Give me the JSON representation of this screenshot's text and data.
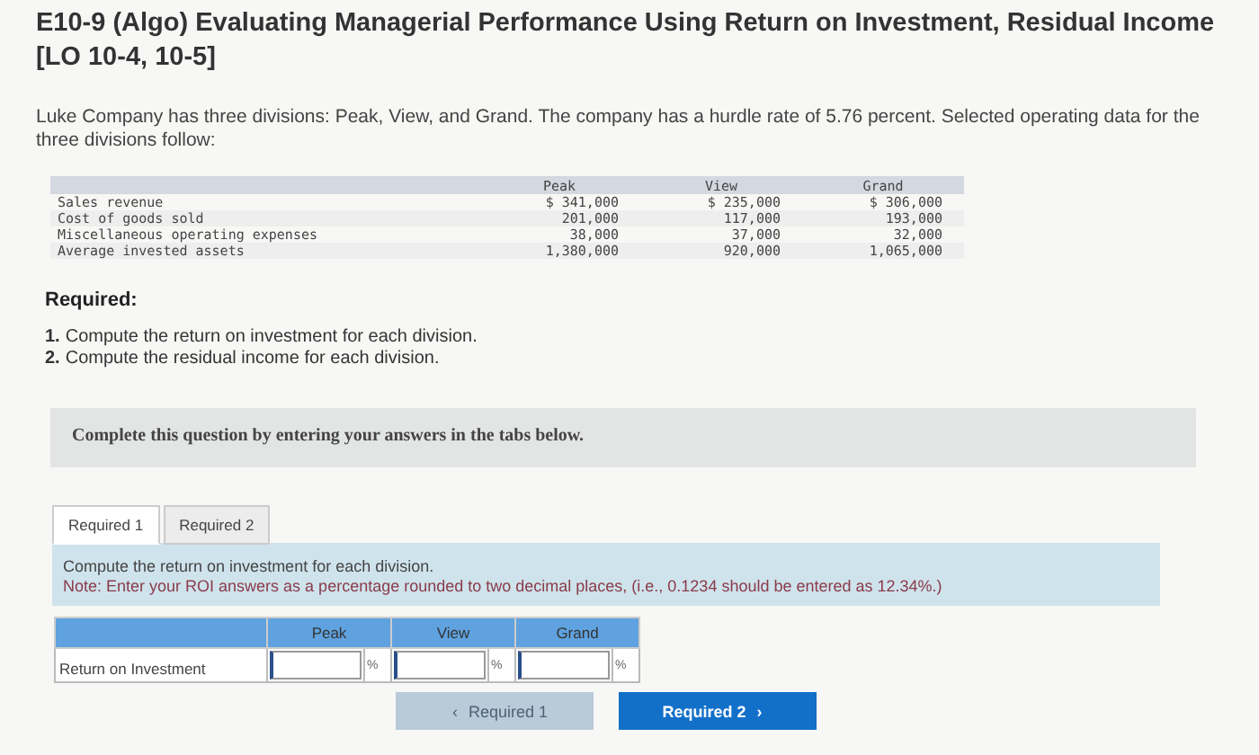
{
  "title": "E10-9 (Algo) Evaluating Managerial Performance Using Return on Investment, Residual Income [LO 10-4, 10-5]",
  "intro": "Luke Company has three divisions: Peak, View, and Grand. The company has a hurdle rate of 5.76 percent. Selected operating data for the three divisions follow:",
  "data_table": {
    "columns": [
      "Peak",
      "View",
      "Grand"
    ],
    "rows": [
      {
        "label": "Sales revenue",
        "values": [
          "$ 341,000",
          "$ 235,000",
          "$ 306,000"
        ]
      },
      {
        "label": "Cost of goods sold",
        "values": [
          "201,000",
          "117,000",
          "193,000"
        ]
      },
      {
        "label": "Miscellaneous operating expenses",
        "values": [
          "38,000",
          "37,000",
          "32,000"
        ]
      },
      {
        "label": "Average invested assets",
        "values": [
          "1,380,000",
          "920,000",
          "1,065,000"
        ]
      }
    ]
  },
  "required_heading": "Required:",
  "required_items": [
    {
      "number": "1.",
      "text": "Compute the return on investment for each division."
    },
    {
      "number": "2.",
      "text": "Compute the residual income for each division."
    }
  ],
  "banner": "Complete this question by entering your answers in the tabs below.",
  "tabs": [
    {
      "label": "Required 1",
      "selected": true
    },
    {
      "label": "Required 2",
      "selected": false
    }
  ],
  "instruction": "Compute the return on investment for each division.",
  "note": "Note: Enter your ROI answers as a percentage rounded to two decimal places, (i.e., 0.1234 should be entered as 12.34%.)",
  "answer_table": {
    "columns": [
      "Peak",
      "View",
      "Grand"
    ],
    "rows": [
      {
        "label": "Return on Investment",
        "cells": [
          {
            "unit": "%"
          },
          {
            "unit": "%"
          },
          {
            "unit": "%"
          }
        ]
      }
    ]
  },
  "nav_buttons": [
    {
      "icon_before": "‹",
      "label": "Required 1",
      "disabled": true
    },
    {
      "label": "Required 2",
      "icon_after": "›",
      "disabled": false
    }
  ]
}
